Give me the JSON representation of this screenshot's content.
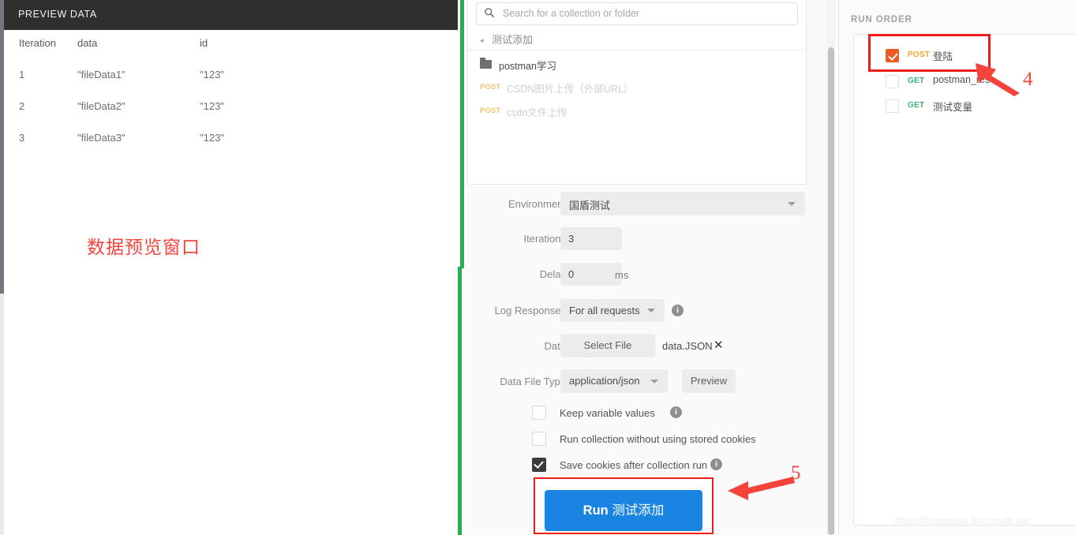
{
  "preview": {
    "header_title": "PREVIEW DATA",
    "note": "数据预览窗口",
    "columns": [
      "Iteration",
      "data",
      "id"
    ],
    "rows": [
      {
        "iteration": "1",
        "data": "\"fileData1\"",
        "id": "\"123\""
      },
      {
        "iteration": "2",
        "data": "\"fileData2\"",
        "id": "\"123\""
      },
      {
        "iteration": "3",
        "data": "\"fileData3\"",
        "id": "\"123\""
      }
    ]
  },
  "runner": {
    "search": {
      "placeholder": "Search for a collection or folder",
      "value": "",
      "icon": "search-icon"
    },
    "breadcrumb": {
      "caret": "◂",
      "label": "测试添加"
    },
    "collection_items": [
      {
        "type": "folder",
        "label": "postman学习",
        "method": ""
      },
      {
        "type": "request",
        "label": "CSDN图片上传（外部URL）",
        "method": "POST"
      },
      {
        "type": "request",
        "label": "csdn文件上传",
        "method": "POST"
      }
    ],
    "fields": {
      "environment_label": "Environment",
      "environment_value": "国盾测试",
      "iterations_label": "Iterations",
      "iterations_value": "3",
      "delay_label": "Delay",
      "delay_value": "0",
      "delay_unit": "ms",
      "log_responses_label": "Log Responses",
      "log_responses_value": "For all requests",
      "data_label": "Data",
      "select_file_button": "Select File",
      "data_file_name": "data.JSON",
      "data_file_clear": "✕",
      "data_file_type_label": "Data File Type",
      "data_file_type_value": "application/json",
      "preview_button": "Preview"
    },
    "checkboxes": [
      {
        "label": "Keep variable values",
        "checked": false,
        "info": true
      },
      {
        "label": "Run collection without using stored cookies",
        "checked": false,
        "info": false
      },
      {
        "label": "Save cookies after collection run",
        "checked": true,
        "info": true
      }
    ],
    "run_button": {
      "prefix": "Run",
      "target": "测试添加"
    }
  },
  "run_order": {
    "title": "RUN ORDER",
    "items": [
      {
        "method": "POST",
        "name": "登陆",
        "checked": true
      },
      {
        "method": "GET",
        "name": "postman_res",
        "checked": false
      },
      {
        "method": "GET",
        "name": "测试变量",
        "checked": false
      }
    ]
  },
  "watermark": "https://keepgoon.blog.csdn.net",
  "annotations": [
    {
      "id": "4",
      "label": "4"
    },
    {
      "id": "5",
      "label": "5"
    }
  ],
  "colors": {
    "accent_blue": "#1a84e2",
    "annotation_red": "#f01d1d",
    "divider_green": "#27ae4d",
    "post_orange": "#f0a52c",
    "get_green": "#3bb273",
    "checkbox_orange": "#ec5b26",
    "header_dark": "#2f2f2f"
  }
}
